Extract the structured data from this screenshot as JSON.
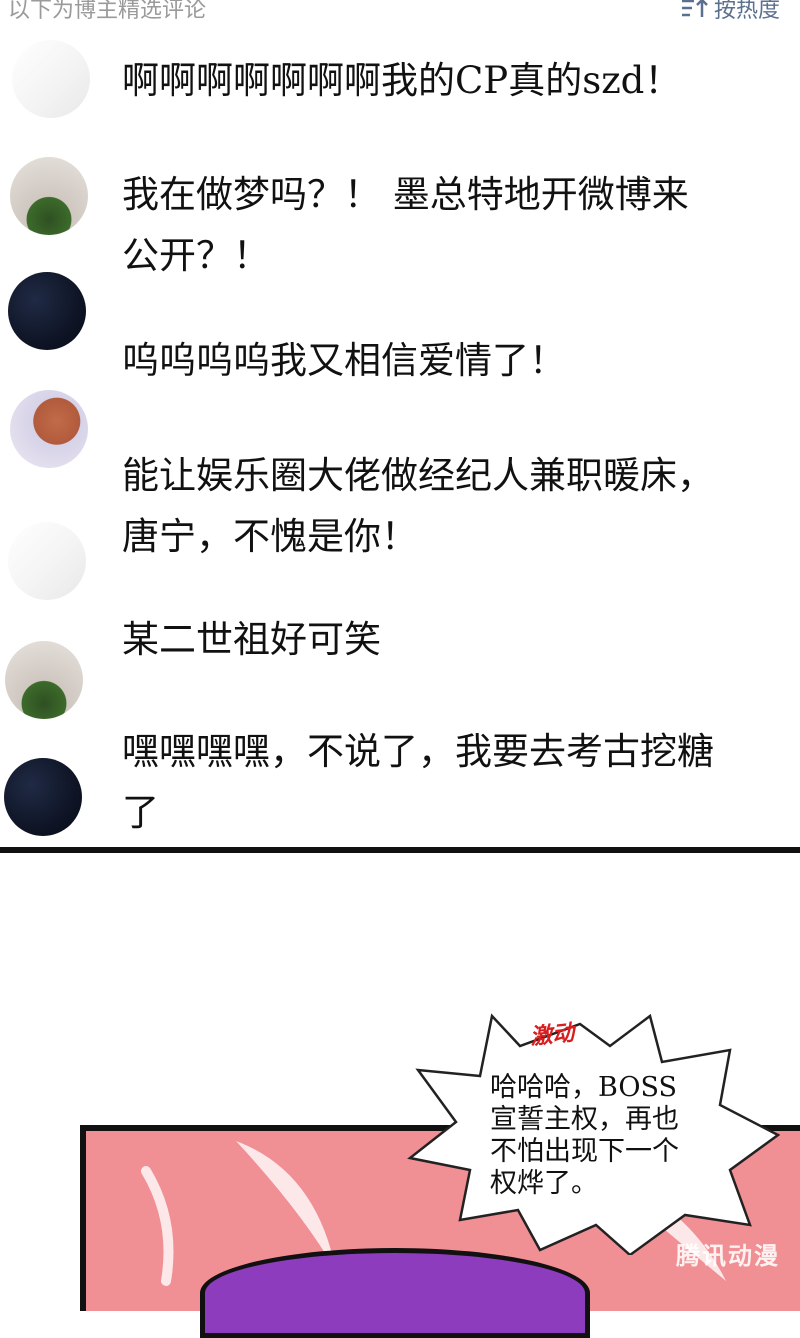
{
  "header": {
    "title": "以下为博主精选评论",
    "sort_label": "按热度"
  },
  "comments": [
    {
      "avatar_icon": "person-avatar-icon",
      "text": "啊啊啊啊啊啊啊我的CP真的szd！"
    },
    {
      "avatar_icon": "watermelon-avatar-icon",
      "text": "我在做梦吗？！ 墨总特地开微博来\n公开？！"
    },
    {
      "avatar_icon": "night-sky-avatar-icon",
      "text": "呜呜呜呜我又相信爱情了！"
    },
    {
      "avatar_icon": "food-avatar-icon",
      "text": "能让娱乐圈大佬做经纪人兼职暖床，\n唐宁，不愧是你！"
    },
    {
      "avatar_icon": "person-avatar-icon",
      "text": "某二世祖好可笑"
    },
    {
      "avatar_icon": "watermelon-avatar-icon",
      "text": "嘿嘿嘿嘿，不说了，我要去考古挖糖\n了"
    }
  ],
  "comic": {
    "sfx": "激动",
    "speech": "哈哈哈，BOSS\n宣誓主权，再也\n不怕出现下一个\n权烨了。",
    "watermark": "腾讯动漫",
    "colors": {
      "panel_bg": "#f08f94",
      "hair": "#8d3cbe",
      "sfx": "#d81e1e"
    }
  }
}
